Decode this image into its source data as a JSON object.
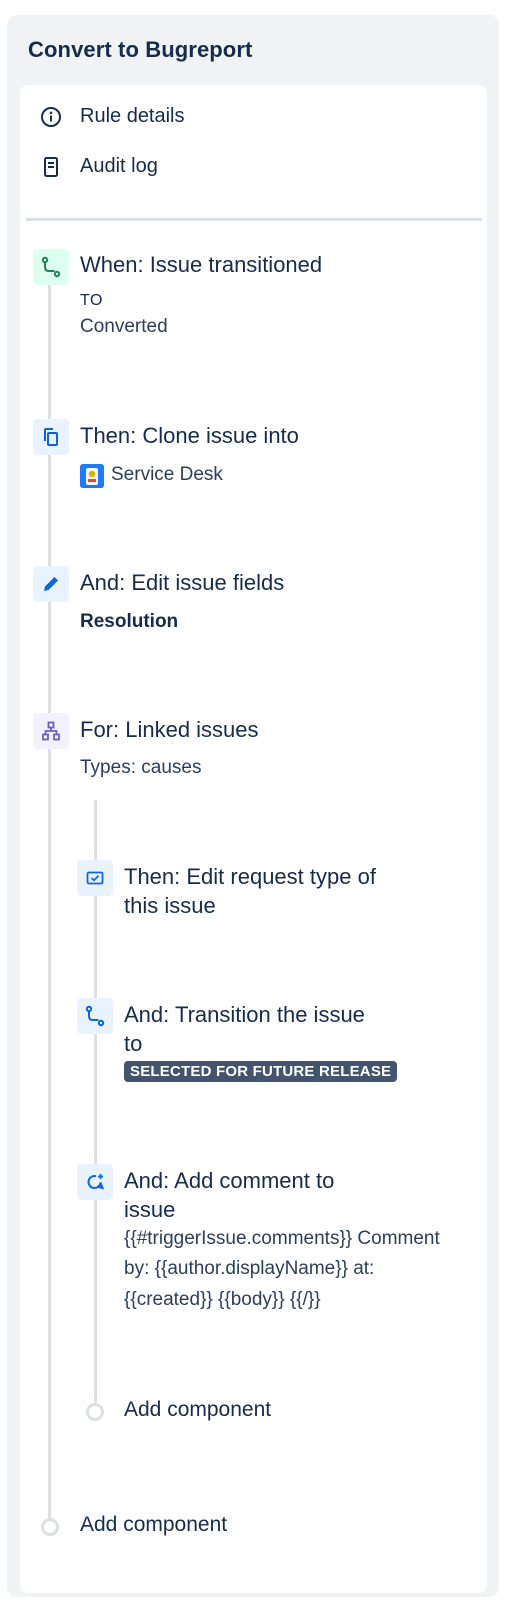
{
  "title": "Convert to Bugreport",
  "menu": {
    "rule_details": "Rule details",
    "audit_log": "Audit log"
  },
  "steps": {
    "trigger": {
      "title": "When: Issue transitioned",
      "to_label": "TO",
      "status": "Converted",
      "color": "#1f845a",
      "bg": "#dcfff1",
      "icon": "transition-icon"
    },
    "clone": {
      "title": "Then: Clone issue into",
      "project": "Service Desk",
      "icon": "copy-icon"
    },
    "edit": {
      "title": "And: Edit issue fields",
      "field": "Resolution",
      "icon": "pencil-icon"
    },
    "branch": {
      "title": "For: Linked issues",
      "types": "Types: causes",
      "color": "#6e5dc6",
      "icon": "hierarchy-icon"
    },
    "edit_request": {
      "title_line1": "Then: Edit request type of",
      "title_line2": "this issue",
      "icon": "request-type-icon"
    },
    "transition": {
      "title_line1": "And: Transition the issue",
      "title_line2": "to",
      "status": "SELECTED FOR FUTURE RELEASE",
      "icon": "transition-icon"
    },
    "comment": {
      "title_line1": "And: Add comment to",
      "title_line2": "issue",
      "body_line1": "{{#triggerIssue.comments}} Comment",
      "body_line2": "by: {{author.displayName}} at:",
      "body_line3": "{{created}} {{body}} {{/}}",
      "icon": "comment-add-icon"
    }
  },
  "add_component_inner": "Add component",
  "add_component_outer": "Add component",
  "colors": {
    "action_blue": "#0c66e4",
    "action_bg": "#e9f2ff",
    "line": "#dcdfe4",
    "lozenge": "#44546f"
  }
}
